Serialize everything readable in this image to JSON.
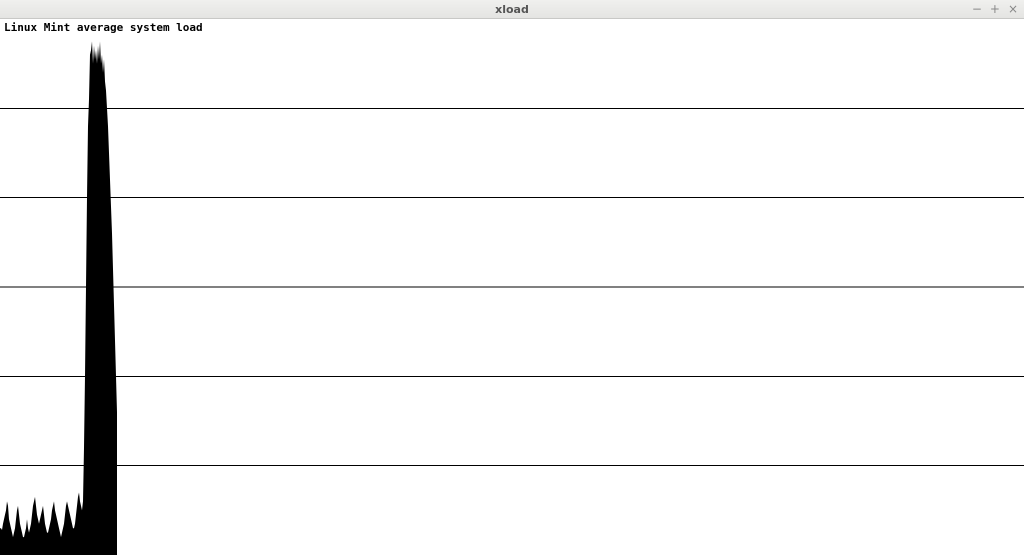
{
  "window": {
    "title": "xload",
    "minimize_icon": "−",
    "maximize_icon": "+",
    "close_icon": "×"
  },
  "label": "Linux Mint average system load",
  "chart_data": {
    "type": "area",
    "title": "Linux Mint average system load",
    "xlabel": "",
    "ylabel": "",
    "ylim": [
      0,
      6
    ],
    "grid_y_interval": 1,
    "x": [
      0,
      1,
      2,
      3,
      4,
      5,
      6,
      7,
      8,
      9,
      10,
      11,
      12,
      13,
      14,
      15,
      16,
      17,
      18,
      19,
      20,
      21,
      22,
      23,
      24,
      25,
      26,
      27,
      28,
      29,
      30,
      31,
      32,
      33,
      34,
      35,
      36,
      37,
      38,
      39,
      40,
      41,
      42,
      43,
      44,
      45,
      46,
      47,
      48,
      49,
      50,
      51,
      52,
      53,
      54,
      55,
      56,
      57,
      58,
      59,
      60,
      61,
      62,
      63,
      64,
      65,
      66,
      67,
      68,
      69,
      70,
      71,
      72,
      73,
      74,
      75,
      76,
      77,
      78,
      79,
      80,
      81,
      82,
      83,
      84,
      85,
      86,
      87,
      88,
      89,
      90,
      91,
      92,
      93,
      94,
      95,
      96,
      97,
      98,
      99,
      100,
      101,
      102,
      103,
      104,
      105,
      106,
      107,
      108,
      109,
      110,
      111,
      112,
      113,
      114,
      115,
      116,
      117
    ],
    "values": [
      0.3,
      0.3,
      0.28,
      0.35,
      0.4,
      0.45,
      0.5,
      0.6,
      0.55,
      0.4,
      0.35,
      0.3,
      0.25,
      0.2,
      0.25,
      0.3,
      0.4,
      0.5,
      0.55,
      0.45,
      0.35,
      0.3,
      0.25,
      0.2,
      0.2,
      0.25,
      0.3,
      0.4,
      0.3,
      0.25,
      0.3,
      0.35,
      0.45,
      0.55,
      0.6,
      0.65,
      0.55,
      0.45,
      0.4,
      0.35,
      0.4,
      0.45,
      0.5,
      0.55,
      0.45,
      0.35,
      0.3,
      0.25,
      0.25,
      0.3,
      0.35,
      0.4,
      0.5,
      0.55,
      0.6,
      0.5,
      0.45,
      0.4,
      0.35,
      0.3,
      0.25,
      0.2,
      0.25,
      0.3,
      0.35,
      0.45,
      0.55,
      0.6,
      0.55,
      0.5,
      0.45,
      0.4,
      0.35,
      0.3,
      0.3,
      0.35,
      0.45,
      0.55,
      0.65,
      0.7,
      0.6,
      0.55,
      0.5,
      0.6,
      1.2,
      2.0,
      3.0,
      4.0,
      4.8,
      5.1,
      5.6,
      5.65,
      5.75,
      5.5,
      5.7,
      5.55,
      5.65,
      5.5,
      5.7,
      5.55,
      5.75,
      5.5,
      5.6,
      5.4,
      5.55,
      5.3,
      5.2,
      5.0,
      4.8,
      4.5,
      4.2,
      3.9,
      3.6,
      3.2,
      2.8,
      2.4,
      2.0,
      1.6
    ]
  }
}
